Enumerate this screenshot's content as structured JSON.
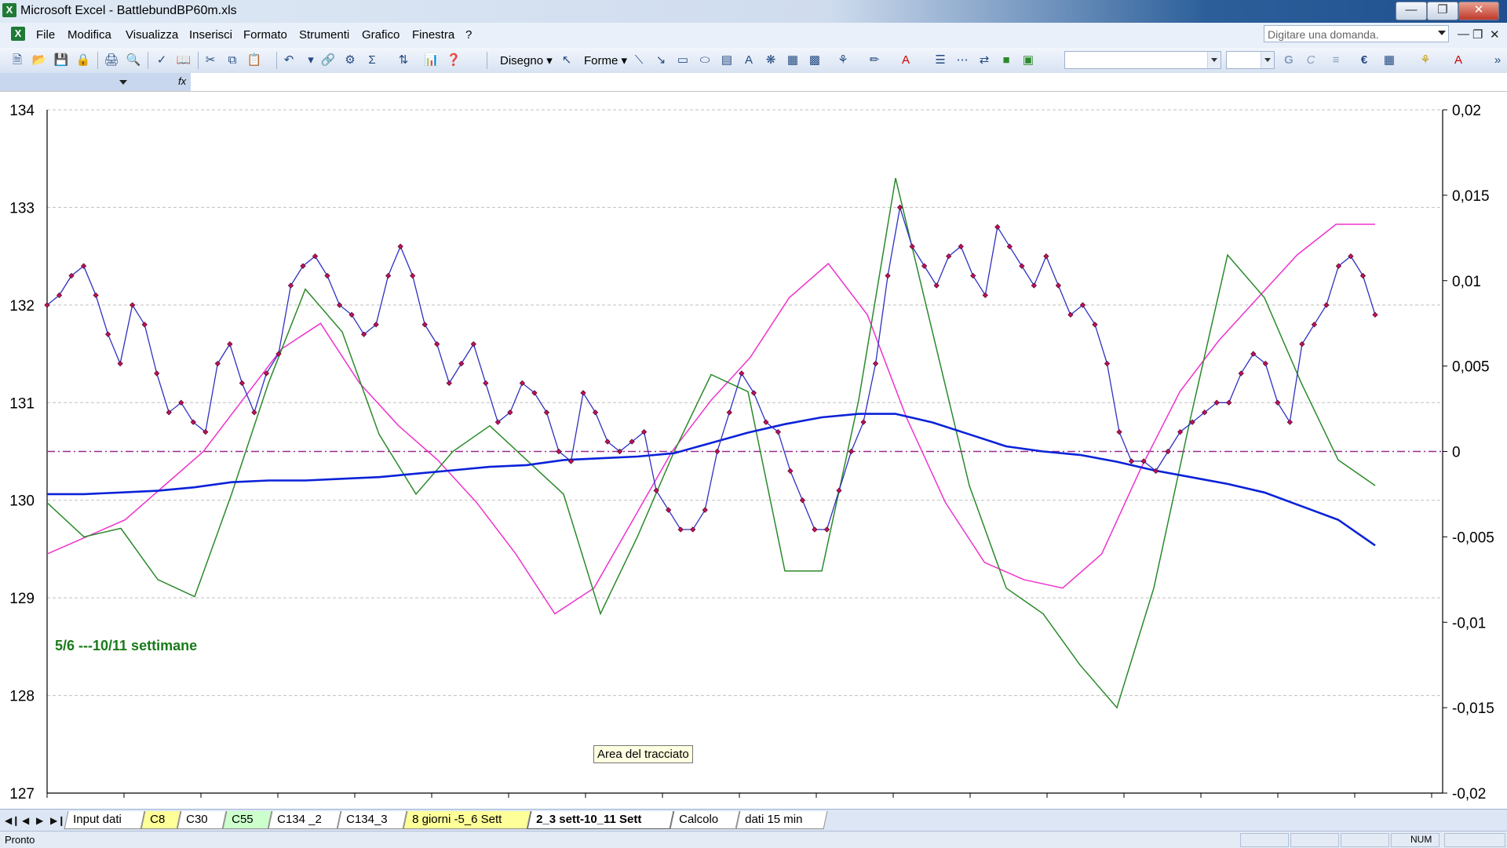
{
  "window": {
    "title": "Microsoft Excel - BattlebundBP60m.xls",
    "app_icon": "X",
    "buttons": [
      "minimize",
      "maximize",
      "close"
    ]
  },
  "menu": {
    "items": [
      "File",
      "Modifica",
      "Visualizza",
      "Inserisci",
      "Formato",
      "Strumenti",
      "Grafico",
      "Finestra",
      "?"
    ],
    "ask_placeholder": "Digitare una domanda."
  },
  "toolbar": {
    "draw_label": "Disegno",
    "shapes_label": "Forme",
    "icons": [
      "new-icon",
      "open-icon",
      "save-icon",
      "permission-icon",
      "print-icon",
      "print-preview-icon",
      "spelling-icon",
      "research-icon",
      "cut-icon",
      "copy-icon",
      "paste-icon",
      "undo-icon",
      "redo-icon",
      "hyperlink-icon",
      "autosum-icon",
      "sort-icon",
      "chart-wizard-icon",
      "help-icon"
    ],
    "format_buttons": [
      "G",
      "C",
      "€"
    ]
  },
  "formula_bar": {
    "name_box": "",
    "fx": "fx",
    "content": ""
  },
  "chart": {
    "annotation": "5/6 ---10/11 settimane",
    "tooltip": "Area del tracciato",
    "left_axis_ticks": [
      "134",
      "133",
      "132",
      "131",
      "130",
      "129",
      "128",
      "127"
    ],
    "right_axis_ticks": [
      "0,02",
      "0,015",
      "0,01",
      "0,005",
      "0",
      "-0,005",
      "-0,01",
      "-0,015",
      "-0,02"
    ],
    "colors": {
      "price": "#3030c0",
      "price_marker": "#c0105a",
      "blue_ma": "#0a22d8",
      "green_osc": "#2a8a2a",
      "magenta_osc": "#ee33cc",
      "zero_line": "#9a2a8a",
      "grid": "#c0c0c0"
    }
  },
  "chart_data": {
    "type": "line",
    "title": "",
    "xlabel": "",
    "ylabel": "",
    "ylim": [
      127,
      134
    ],
    "y2lim": [
      -0.02,
      0.02
    ],
    "grid": true,
    "legend": "none",
    "series": [
      {
        "axis": "left",
        "marker": "diamond",
        "values": [
          132.0,
          132.1,
          132.3,
          132.4,
          132.1,
          131.7,
          131.4,
          132.0,
          131.8,
          131.3,
          130.9,
          131.0,
          130.8,
          130.7,
          131.4,
          131.6,
          131.2,
          130.9,
          131.3,
          131.5,
          132.2,
          132.4,
          132.5,
          132.3,
          132.0,
          131.9,
          131.7,
          131.8,
          132.3,
          132.6,
          132.3,
          131.8,
          131.6,
          131.2,
          131.4,
          131.6,
          131.2,
          130.8,
          130.9,
          131.2,
          131.1,
          130.9,
          130.5,
          130.4,
          131.1,
          130.9,
          130.6,
          130.5,
          130.6,
          130.7,
          130.1,
          129.9,
          129.7,
          129.7,
          129.9,
          130.5,
          130.9,
          131.3,
          131.1,
          130.8,
          130.7,
          130.3,
          130.0,
          129.7,
          129.7,
          130.1,
          130.5,
          130.8,
          131.4,
          132.3,
          133.0,
          132.6,
          132.4,
          132.2,
          132.5,
          132.6,
          132.3,
          132.1,
          132.8,
          132.6,
          132.4,
          132.2,
          132.5,
          132.2,
          131.9,
          132.0,
          131.8,
          131.4,
          130.7,
          130.4,
          130.4,
          130.3,
          130.5,
          130.7,
          130.8,
          130.9,
          131.0,
          131.0,
          131.3,
          131.5,
          131.4,
          131.0,
          130.8,
          131.6,
          131.8,
          132.0,
          132.4,
          132.5,
          132.3,
          131.9
        ],
        "x_range": [
          0,
          1
        ]
      },
      {
        "axis": "right",
        "values": [
          -0.0025,
          -0.0025,
          -0.0024,
          -0.0023,
          -0.0021,
          -0.0018,
          -0.0017,
          -0.0017,
          -0.0016,
          -0.0015,
          -0.0013,
          -0.0011,
          -0.0009,
          -0.0008,
          -0.0005,
          -0.0004,
          -0.0003,
          -0.0001,
          0.0005,
          0.0011,
          0.0016,
          0.002,
          0.0022,
          0.0022,
          0.0017,
          0.001,
          0.0003,
          0.0,
          -0.0002,
          -0.0006,
          -0.0011,
          -0.0015,
          -0.0019,
          -0.0024,
          -0.0032,
          -0.004,
          -0.0055
        ]
      },
      {
        "axis": "right",
        "values": [
          -0.003,
          -0.005,
          -0.0045,
          -0.0075,
          -0.0085,
          -0.0025,
          0.004,
          0.0095,
          0.007,
          0.001,
          -0.0025,
          0.0,
          0.0015,
          -0.0005,
          -0.0025,
          -0.0095,
          -0.005,
          0.0,
          0.0045,
          0.0035,
          -0.007,
          -0.007,
          0.003,
          0.016,
          0.007,
          -0.002,
          -0.008,
          -0.0095,
          -0.0125,
          -0.015,
          -0.008,
          0.002,
          0.0115,
          0.009,
          0.004,
          -0.0005,
          -0.002
        ]
      },
      {
        "axis": "right",
        "values": [
          -0.006,
          -0.005,
          -0.004,
          -0.002,
          0.0,
          0.003,
          0.006,
          0.0075,
          0.004,
          0.0015,
          -0.0005,
          -0.003,
          -0.006,
          -0.0095,
          -0.008,
          -0.004,
          0.0,
          0.003,
          0.0055,
          0.009,
          0.011,
          0.008,
          0.002,
          -0.003,
          -0.0065,
          -0.0075,
          -0.008,
          -0.006,
          -0.001,
          0.0035,
          0.0065,
          0.009,
          0.0115,
          0.0133,
          0.0133
        ]
      }
    ]
  },
  "sheets": {
    "tabs": [
      {
        "label": "Input dati",
        "color": "white"
      },
      {
        "label": "C8",
        "color": "yellow"
      },
      {
        "label": "C30",
        "color": "white"
      },
      {
        "label": "C55",
        "color": "green"
      },
      {
        "label": "C134 _2",
        "color": "white"
      },
      {
        "label": "C134_3",
        "color": "white"
      },
      {
        "label": "8 giorni -5_6 Sett",
        "color": "yellow"
      },
      {
        "label": "2_3 sett-10_11 Sett",
        "color": "active"
      },
      {
        "label": "Calcolo",
        "color": "white"
      },
      {
        "label": "dati 15 min",
        "color": "white"
      }
    ]
  },
  "status": {
    "text": "Pronto",
    "num": "NUM"
  }
}
